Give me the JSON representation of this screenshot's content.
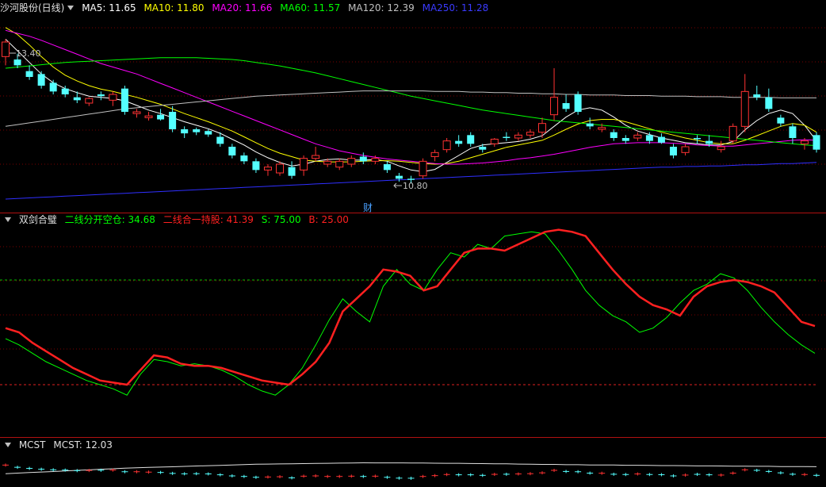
{
  "price_panel": {
    "stock_name": "沙河股份(日线)",
    "ma": [
      {
        "label": "MA5: 11.65",
        "color": "#ffffff"
      },
      {
        "label": "MA10: 11.80",
        "color": "#ffff00"
      },
      {
        "label": "MA20: 11.66",
        "color": "#ff00ff"
      },
      {
        "label": "MA60: 11.57",
        "color": "#00ff00"
      },
      {
        "label": "MA120: 12.39",
        "color": "#c0c0c0"
      },
      {
        "label": "MA250: 11.28",
        "color": "#3a3aff"
      }
    ],
    "high_label": "13.40",
    "low_label": "10.80",
    "cai_marker": "财"
  },
  "indicator_panel": {
    "name": "双剑合璧",
    "line1_label": "二线分开空仓: 34.68",
    "line2_label": "二线合一持股: 41.39",
    "s_label": "S: 75.00",
    "b_label": "B: 25.00",
    "colors": {
      "line1": "#00ff00",
      "line2": "#ff2020",
      "s": "#00ff00",
      "b": "#ff2020"
    }
  },
  "mcst_panel": {
    "name": "MCST",
    "value_label": "MCST: 12.03"
  },
  "chart_data": {
    "type": "candlestick",
    "y_range": [
      10.5,
      13.8
    ],
    "candles": [
      [
        13.1,
        13.4,
        12.95,
        13.35
      ],
      [
        13.05,
        13.15,
        12.9,
        12.95
      ],
      [
        12.85,
        12.95,
        12.7,
        12.75
      ],
      [
        12.8,
        12.85,
        12.55,
        12.6
      ],
      [
        12.65,
        12.7,
        12.45,
        12.5
      ],
      [
        12.55,
        12.6,
        12.4,
        12.45
      ],
      [
        12.4,
        12.5,
        12.3,
        12.35
      ],
      [
        12.3,
        12.4,
        12.25,
        12.38
      ],
      [
        12.45,
        12.5,
        12.35,
        12.42
      ],
      [
        12.35,
        12.5,
        12.25,
        12.45
      ],
      [
        12.55,
        12.6,
        12.1,
        12.15
      ],
      [
        12.12,
        12.2,
        12.05,
        12.15
      ],
      [
        12.05,
        12.15,
        12.0,
        12.08
      ],
      [
        12.1,
        12.2,
        12.0,
        12.02
      ],
      [
        12.15,
        12.25,
        11.8,
        11.85
      ],
      [
        11.85,
        11.9,
        11.7,
        11.78
      ],
      [
        11.85,
        11.88,
        11.75,
        11.8
      ],
      [
        11.82,
        11.85,
        11.72,
        11.76
      ],
      [
        11.72,
        11.8,
        11.55,
        11.6
      ],
      [
        11.55,
        11.6,
        11.35,
        11.4
      ],
      [
        11.4,
        11.45,
        11.25,
        11.3
      ],
      [
        11.3,
        11.35,
        11.1,
        11.15
      ],
      [
        11.15,
        11.25,
        11.05,
        11.2
      ],
      [
        11.1,
        11.3,
        11.05,
        11.25
      ],
      [
        11.2,
        11.3,
        11.0,
        11.05
      ],
      [
        11.15,
        11.4,
        11.05,
        11.35
      ],
      [
        11.35,
        11.55,
        11.3,
        11.4
      ],
      [
        11.25,
        11.35,
        11.2,
        11.3
      ],
      [
        11.2,
        11.35,
        11.15,
        11.3
      ],
      [
        11.25,
        11.4,
        11.2,
        11.35
      ],
      [
        11.38,
        11.45,
        11.25,
        11.3
      ],
      [
        11.3,
        11.4,
        11.25,
        11.35
      ],
      [
        11.25,
        11.3,
        11.1,
        11.15
      ],
      [
        11.05,
        11.1,
        10.95,
        11.0
      ],
      [
        11.0,
        11.05,
        10.92,
        10.98
      ],
      [
        11.05,
        11.35,
        11.0,
        11.3
      ],
      [
        11.38,
        11.5,
        11.3,
        11.45
      ],
      [
        11.5,
        11.7,
        11.45,
        11.65
      ],
      [
        11.65,
        11.75,
        11.55,
        11.6
      ],
      [
        11.75,
        11.8,
        11.55,
        11.6
      ],
      [
        11.55,
        11.6,
        11.45,
        11.5
      ],
      [
        11.6,
        11.7,
        11.55,
        11.68
      ],
      [
        11.72,
        11.8,
        11.65,
        11.7
      ],
      [
        11.7,
        11.8,
        11.65,
        11.75
      ],
      [
        11.75,
        11.85,
        11.7,
        11.8
      ],
      [
        11.8,
        12.05,
        11.7,
        11.95
      ],
      [
        12.1,
        12.9,
        12.0,
        12.4
      ],
      [
        12.3,
        12.45,
        12.15,
        12.2
      ],
      [
        12.45,
        12.5,
        12.1,
        12.15
      ],
      [
        11.95,
        12.05,
        11.85,
        11.9
      ],
      [
        11.85,
        11.95,
        11.8,
        11.88
      ],
      [
        11.8,
        11.85,
        11.65,
        11.7
      ],
      [
        11.7,
        11.75,
        11.6,
        11.65
      ],
      [
        11.7,
        11.8,
        11.65,
        11.75
      ],
      [
        11.75,
        11.8,
        11.6,
        11.65
      ],
      [
        11.72,
        11.78,
        11.6,
        11.62
      ],
      [
        11.55,
        11.6,
        11.35,
        11.4
      ],
      [
        11.45,
        11.6,
        11.4,
        11.55
      ],
      [
        11.7,
        11.75,
        11.6,
        11.68
      ],
      [
        11.65,
        11.75,
        11.55,
        11.6
      ],
      [
        11.5,
        11.65,
        11.45,
        11.55
      ],
      [
        11.65,
        11.95,
        11.6,
        11.9
      ],
      [
        11.9,
        12.8,
        11.8,
        12.5
      ],
      [
        12.45,
        12.6,
        12.35,
        12.4
      ],
      [
        12.4,
        12.55,
        12.15,
        12.2
      ],
      [
        12.05,
        12.1,
        11.9,
        11.95
      ],
      [
        11.9,
        11.95,
        11.6,
        11.7
      ],
      [
        11.6,
        11.7,
        11.5,
        11.65
      ],
      [
        11.75,
        11.8,
        11.45,
        11.5
      ]
    ],
    "ma_lines": {
      "MA5": [
        13.4,
        13.2,
        13.0,
        12.8,
        12.65,
        12.55,
        12.48,
        12.42,
        12.4,
        12.38,
        12.34,
        12.26,
        12.18,
        12.12,
        12.05,
        11.98,
        11.92,
        11.86,
        11.78,
        11.68,
        11.58,
        11.46,
        11.36,
        11.28,
        11.22,
        11.25,
        11.3,
        11.33,
        11.34,
        11.32,
        11.32,
        11.33,
        11.3,
        11.22,
        11.15,
        11.12,
        11.16,
        11.28,
        11.4,
        11.52,
        11.58,
        11.6,
        11.62,
        11.64,
        11.68,
        11.74,
        11.9,
        12.06,
        12.18,
        12.22,
        12.18,
        12.06,
        11.92,
        11.82,
        11.76,
        11.7,
        11.66,
        11.62,
        11.6,
        11.58,
        11.58,
        11.64,
        11.84,
        12.0,
        12.12,
        12.18,
        12.12,
        11.92,
        11.65
      ],
      "MA10": [
        13.6,
        13.48,
        13.3,
        13.1,
        12.92,
        12.78,
        12.68,
        12.6,
        12.54,
        12.5,
        12.45,
        12.4,
        12.34,
        12.28,
        12.2,
        12.12,
        12.05,
        11.98,
        11.9,
        11.82,
        11.72,
        11.62,
        11.52,
        11.44,
        11.38,
        11.32,
        11.3,
        11.29,
        11.29,
        11.29,
        11.3,
        11.31,
        11.31,
        11.3,
        11.28,
        11.26,
        11.25,
        11.26,
        11.3,
        11.36,
        11.42,
        11.48,
        11.54,
        11.58,
        11.62,
        11.66,
        11.75,
        11.85,
        11.94,
        12.0,
        12.02,
        12.02,
        11.98,
        11.92,
        11.86,
        11.8,
        11.75,
        11.7,
        11.66,
        11.62,
        11.6,
        11.6,
        11.66,
        11.74,
        11.82,
        11.9,
        11.95,
        11.92,
        11.8
      ],
      "MA20": [
        13.55,
        13.5,
        13.45,
        13.38,
        13.3,
        13.22,
        13.14,
        13.06,
        12.98,
        12.92,
        12.86,
        12.8,
        12.72,
        12.64,
        12.56,
        12.48,
        12.4,
        12.32,
        12.24,
        12.16,
        12.08,
        12.0,
        11.92,
        11.84,
        11.76,
        11.68,
        11.6,
        11.54,
        11.48,
        11.44,
        11.4,
        11.37,
        11.34,
        11.32,
        11.3,
        11.28,
        11.26,
        11.25,
        11.25,
        11.26,
        11.27,
        11.29,
        11.31,
        11.34,
        11.36,
        11.39,
        11.42,
        11.46,
        11.5,
        11.54,
        11.57,
        11.6,
        11.61,
        11.62,
        11.62,
        11.62,
        11.61,
        11.6,
        11.58,
        11.57,
        11.56,
        11.56,
        11.58,
        11.6,
        11.62,
        11.64,
        11.66,
        11.67,
        11.66
      ],
      "MA60": [
        12.9,
        12.92,
        12.94,
        12.96,
        12.98,
        13.0,
        13.01,
        13.02,
        13.03,
        13.04,
        13.05,
        13.06,
        13.07,
        13.08,
        13.08,
        13.08,
        13.08,
        13.07,
        13.06,
        13.05,
        13.03,
        13.0,
        12.97,
        12.94,
        12.9,
        12.86,
        12.82,
        12.77,
        12.72,
        12.67,
        12.62,
        12.57,
        12.52,
        12.47,
        12.42,
        12.38,
        12.34,
        12.3,
        12.26,
        12.22,
        12.18,
        12.15,
        12.12,
        12.09,
        12.06,
        12.03,
        12.0,
        11.98,
        11.96,
        11.94,
        11.92,
        11.9,
        11.88,
        11.86,
        11.84,
        11.82,
        11.8,
        11.78,
        11.76,
        11.74,
        11.72,
        11.7,
        11.68,
        11.66,
        11.64,
        11.62,
        11.6,
        11.58,
        11.57
      ],
      "MA120": [
        11.9,
        11.93,
        11.96,
        11.99,
        12.02,
        12.05,
        12.08,
        12.11,
        12.14,
        12.17,
        12.2,
        12.22,
        12.24,
        12.26,
        12.28,
        12.3,
        12.32,
        12.34,
        12.36,
        12.38,
        12.4,
        12.42,
        12.43,
        12.44,
        12.45,
        12.46,
        12.47,
        12.48,
        12.49,
        12.5,
        12.51,
        12.51,
        12.51,
        12.51,
        12.51,
        12.51,
        12.5,
        12.5,
        12.5,
        12.49,
        12.49,
        12.48,
        12.48,
        12.47,
        12.47,
        12.46,
        12.46,
        12.45,
        12.45,
        12.44,
        12.44,
        12.44,
        12.43,
        12.43,
        12.43,
        12.42,
        12.42,
        12.42,
        12.41,
        12.41,
        12.41,
        12.4,
        12.4,
        12.4,
        12.4,
        12.39,
        12.39,
        12.39,
        12.39
      ],
      "MA250": [
        10.65,
        10.66,
        10.67,
        10.68,
        10.69,
        10.7,
        10.71,
        10.72,
        10.73,
        10.74,
        10.75,
        10.76,
        10.77,
        10.78,
        10.79,
        10.8,
        10.81,
        10.82,
        10.83,
        10.84,
        10.85,
        10.86,
        10.87,
        10.88,
        10.89,
        10.9,
        10.91,
        10.92,
        10.93,
        10.94,
        10.95,
        10.96,
        10.97,
        10.98,
        10.99,
        11.0,
        11.01,
        11.02,
        11.03,
        11.04,
        11.05,
        11.06,
        11.07,
        11.08,
        11.09,
        11.1,
        11.11,
        11.12,
        11.13,
        11.14,
        11.15,
        11.16,
        11.17,
        11.18,
        11.19,
        11.2,
        11.2,
        11.21,
        11.21,
        11.22,
        11.22,
        11.23,
        11.24,
        11.24,
        11.25,
        11.26,
        11.26,
        11.27,
        11.28
      ]
    },
    "indicator": {
      "y_range": [
        0,
        100
      ],
      "line2_red": [
        52,
        50,
        45,
        41,
        37,
        33,
        30,
        27,
        26,
        25,
        32,
        39,
        38,
        35,
        34,
        34,
        33,
        31,
        29,
        27,
        26,
        25,
        30,
        36,
        45,
        60,
        66,
        72,
        80,
        79,
        77,
        70,
        72,
        80,
        88,
        90,
        90,
        89,
        92,
        95,
        98,
        99,
        98,
        96,
        88,
        80,
        73,
        67,
        63,
        61,
        58,
        67,
        72,
        74,
        75,
        74,
        72,
        69,
        62,
        55,
        53
      ],
      "line1_green": [
        47,
        44,
        40,
        36,
        33,
        30,
        27,
        25,
        23,
        20,
        30,
        37,
        36,
        34,
        35,
        34,
        32,
        29,
        25,
        22,
        20,
        25,
        33,
        44,
        56,
        66,
        60,
        55,
        72,
        80,
        73,
        70,
        80,
        88,
        86,
        92,
        90,
        96,
        97,
        98,
        97,
        89,
        80,
        70,
        63,
        58,
        55,
        50,
        52,
        57,
        64,
        70,
        73,
        78,
        76,
        70,
        62,
        55,
        49,
        44,
        40
      ],
      "s_level": 75,
      "b_level": 25
    },
    "mcst": {
      "value": 12.03
    }
  }
}
